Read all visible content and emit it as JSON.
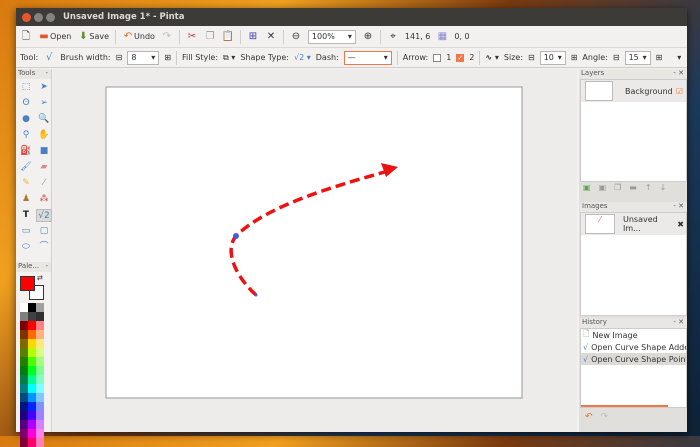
{
  "window": {
    "title": "Unsaved Image 1* - Pinta"
  },
  "toolbar": {
    "open": "Open",
    "save": "Save",
    "undo": "Undo",
    "zoom": "100%",
    "cursor_pos": "141, 6",
    "selection_size": "0, 0"
  },
  "toolopts": {
    "tool_label": "Tool:",
    "brush_width_label": "Brush width:",
    "brush_width": "8",
    "fill_style_label": "Fill Style:",
    "shape_type_label": "Shape Type:",
    "dash_label": "Dash:",
    "dash": "—",
    "arrow_label": "Arrow:",
    "arrow1": "1",
    "arrow2": "2",
    "arrow1_checked": false,
    "arrow2_checked": true,
    "size_label": "Size:",
    "size": "10",
    "angle_label": "Angle:",
    "angle": "15"
  },
  "tools_panel": {
    "title": "Tools"
  },
  "palette_panel": {
    "title": "Pale...",
    "primary": "#ff0000",
    "secondary": "#ffffff",
    "colors": [
      "#ffffff",
      "#000000",
      "#a0a0a0",
      "#808080",
      "#404040",
      "#303030",
      "#7f0000",
      "#ff0000",
      "#ff8080",
      "#7f3300",
      "#ff6a00",
      "#ffb280",
      "#7f6a00",
      "#ffd800",
      "#ffe97f",
      "#5b7f00",
      "#b6ff00",
      "#daff7f",
      "#267f00",
      "#4cff00",
      "#a5ff7f",
      "#007f0e",
      "#00ff21",
      "#7fff8e",
      "#007f46",
      "#00ff90",
      "#7fffc5",
      "#007f7f",
      "#00ffff",
      "#7fffff",
      "#004a7f",
      "#0094ff",
      "#7fc9ff",
      "#00137f",
      "#0026ff",
      "#7f92ff",
      "#21007f",
      "#4800ff",
      "#a17fff",
      "#57007f",
      "#b200ff",
      "#d67fff",
      "#7f006e",
      "#ff00dc",
      "#ff7fed",
      "#7f0037",
      "#ff006e",
      "#ff7fb6"
    ]
  },
  "layers": {
    "title": "Layers",
    "items": [
      {
        "name": "Background",
        "visible": true
      }
    ]
  },
  "images": {
    "title": "Images",
    "items": [
      {
        "name": "Unsaved Im..."
      }
    ]
  },
  "history": {
    "title": "History",
    "items": [
      "New Image",
      "Open Curve Shape Added",
      "Open Curve Shape Point Ad"
    ]
  },
  "accent": "#f07746"
}
